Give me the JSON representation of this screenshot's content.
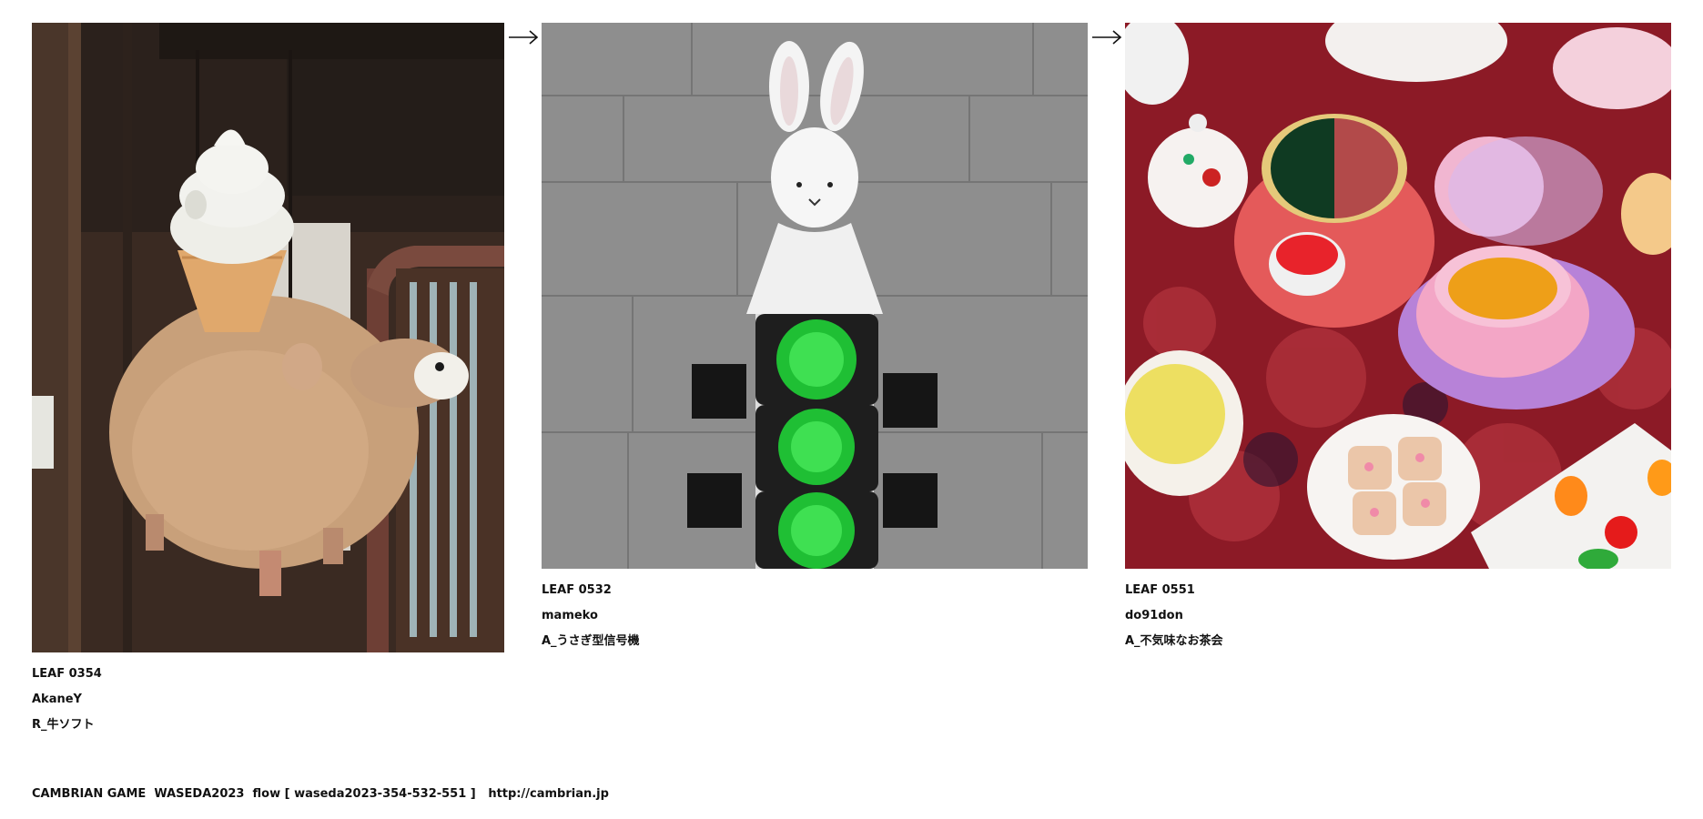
{
  "cards": [
    {
      "leaf": "LEAF 0354",
      "author": "AkaneY",
      "title": "R_牛ソフト",
      "image_alt": "ice-cream-cow-sculpture-photo"
    },
    {
      "leaf": "LEAF 0532",
      "author": "mameko",
      "title": "A_うさぎ型信号機",
      "image_alt": "rabbit-traffic-light-photo"
    },
    {
      "leaf": "LEAF 0551",
      "author": "do91don",
      "title": "A_不気味なお茶会",
      "image_alt": "tea-party-photo"
    }
  ],
  "arrows": [
    "arrow-right-icon",
    "arrow-right-icon"
  ],
  "footer": {
    "text": "CAMBRIAN GAME  WASEDA2023  flow [ waseda2023-354-532-551 ]   ",
    "link": "http://cambrian.jp"
  }
}
